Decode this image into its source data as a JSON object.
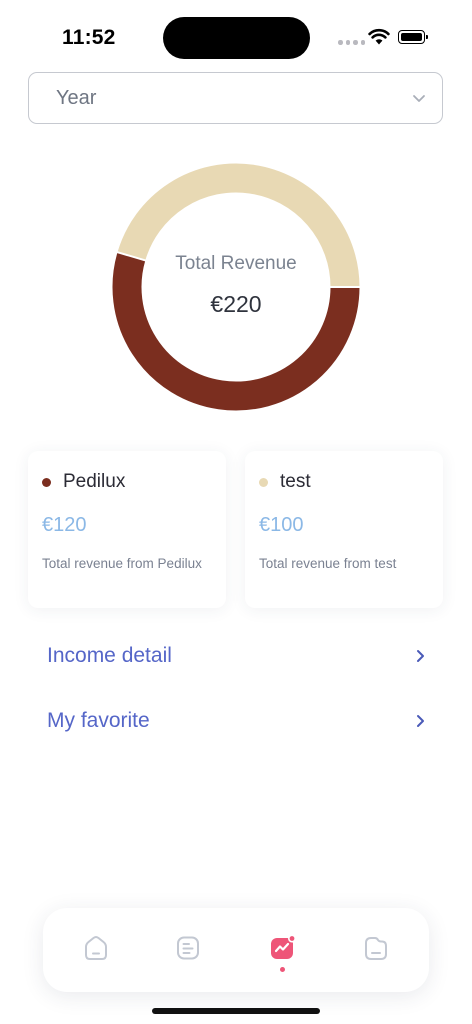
{
  "status": {
    "time": "11:52"
  },
  "filter": {
    "selected": "Year"
  },
  "summary": {
    "title": "Total Revenue",
    "total": "€220"
  },
  "chart_data": {
    "type": "pie",
    "categories": [
      "Pedilux",
      "test"
    ],
    "values": [
      120,
      100
    ],
    "colors": [
      "#7b2e1f",
      "#e8d9b4"
    ],
    "title": "Total Revenue",
    "center_label": "€220",
    "donut": true
  },
  "cards": [
    {
      "name": "Pedilux",
      "amount": "€120",
      "description": "Total revenue from Pedilux",
      "color": "#7b2e1f"
    },
    {
      "name": "test",
      "amount": "€100",
      "description": "Total revenue from test",
      "color": "#e8d9b4"
    }
  ],
  "links": [
    {
      "label": "Income detail"
    },
    {
      "label": "My favorite"
    }
  ],
  "tabbar": {
    "items": [
      {
        "icon": "home-icon"
      },
      {
        "icon": "document-list-icon"
      },
      {
        "icon": "chart-icon",
        "active": true
      },
      {
        "icon": "profile-icon"
      }
    ],
    "active_color": "#ee5578",
    "inactive_color": "#c3c8d2"
  }
}
